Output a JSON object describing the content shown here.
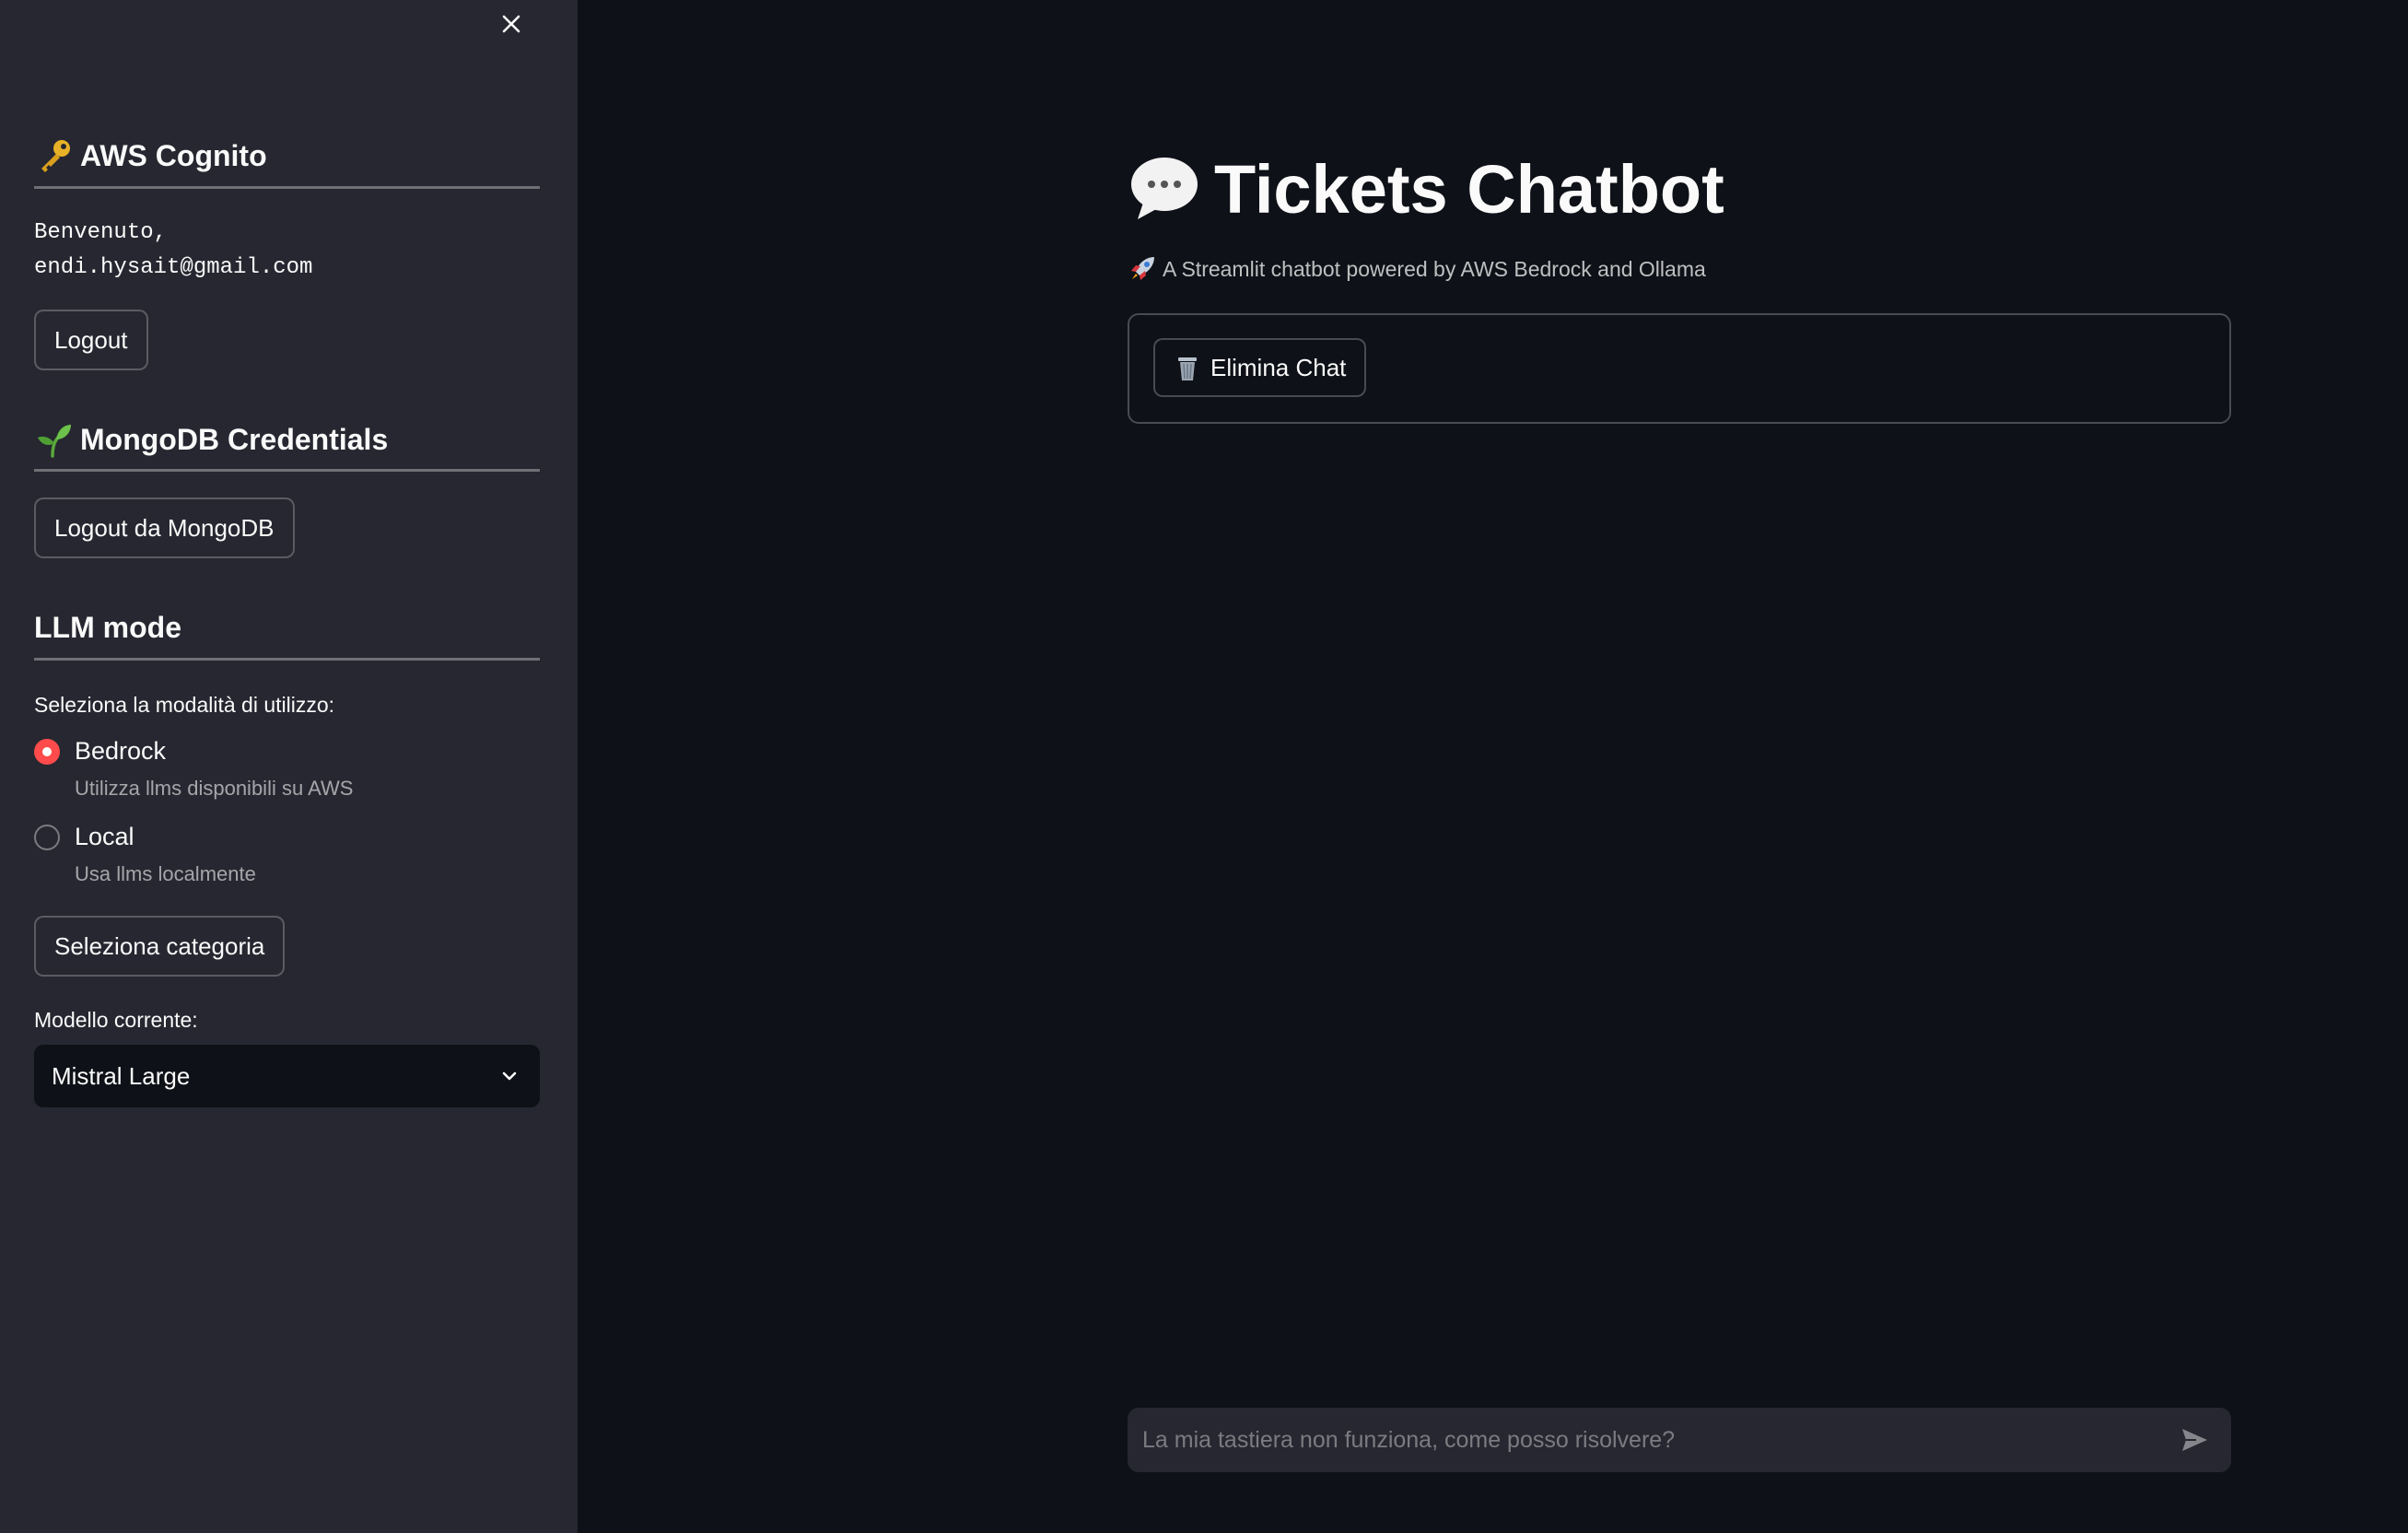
{
  "sidebar": {
    "close_icon": "close-icon",
    "aws_section": {
      "emoji": "key-icon",
      "title": "AWS Cognito",
      "welcome_line1": "Benvenuto,",
      "welcome_line2": "endi.hysait@gmail.com",
      "logout_label": "Logout"
    },
    "mongo_section": {
      "emoji": "seedling-icon",
      "title": "MongoDB Credentials",
      "logout_label": "Logout da MongoDB"
    },
    "llm_section": {
      "title": "LLM mode",
      "radio_label": "Seleziona la modalità di utilizzo:",
      "options": [
        {
          "label": "Bedrock",
          "help": "Utilizza llms disponibili su AWS",
          "checked": true
        },
        {
          "label": "Local",
          "help": "Usa llms localmente",
          "checked": false
        }
      ],
      "category_button_label": "Seleziona categoria",
      "model_label": "Modello corrente:",
      "model_selected": "Mistral Large"
    }
  },
  "main": {
    "title_emoji": "speech-bubble-icon",
    "title": "Tickets Chatbot",
    "subtitle_emoji": "rocket-icon",
    "subtitle": "A Streamlit chatbot powered by AWS Bedrock and Ollama",
    "clear_button_emoji": "wastebasket-icon",
    "clear_button_label": "Elimina Chat",
    "chat_input_placeholder": "La mia tastiera non funziona, come posso risolvere?"
  },
  "colors": {
    "background": "#0e1117",
    "sidebar": "#262730",
    "accent": "#ff4b4b",
    "text": "#fafafa"
  }
}
